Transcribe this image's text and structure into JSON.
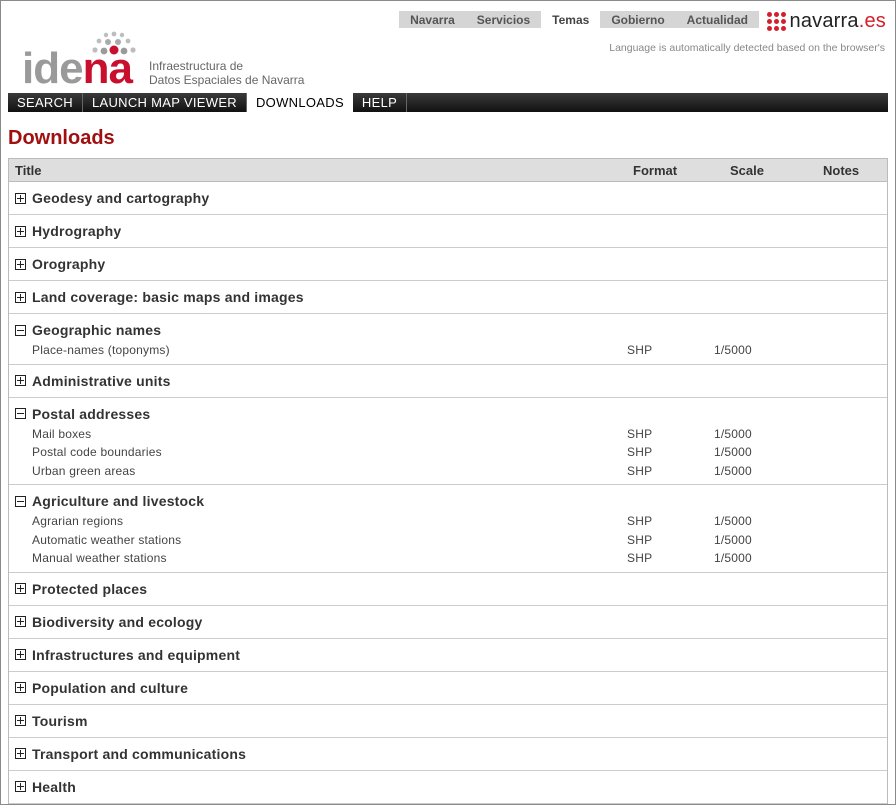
{
  "portal": {
    "nav": [
      {
        "label": "Navarra",
        "active": false
      },
      {
        "label": "Servicios",
        "active": false
      },
      {
        "label": "Temas",
        "active": true
      },
      {
        "label": "Gobierno",
        "active": false
      },
      {
        "label": "Actualidad",
        "active": false
      }
    ],
    "brand_main": "navarra",
    "brand_tld": ".es",
    "language_note": "Language is automatically detected based on the browser's"
  },
  "logo": {
    "word_grey": "ide",
    "word_red": "na",
    "subtitle_line1": "Infraestructura de",
    "subtitle_line2": "Datos Espaciales de Navarra"
  },
  "menu": [
    {
      "label": "SEARCH",
      "active": false
    },
    {
      "label": "LAUNCH MAP VIEWER",
      "active": false
    },
    {
      "label": "DOWNLOADS",
      "active": true
    },
    {
      "label": "HELP",
      "active": false
    }
  ],
  "page_title": "Downloads",
  "table": {
    "headers": {
      "title": "Title",
      "format": "Format",
      "scale": "Scale",
      "notes": "Notes"
    },
    "groups": [
      {
        "name": "Geodesy and cartography",
        "expanded": false,
        "items": []
      },
      {
        "name": "Hydrography",
        "expanded": false,
        "items": []
      },
      {
        "name": "Orography",
        "expanded": false,
        "items": []
      },
      {
        "name": "Land coverage: basic maps and images",
        "expanded": false,
        "items": []
      },
      {
        "name": "Geographic names",
        "expanded": true,
        "items": [
          {
            "title": "Place-names (toponyms)",
            "format": "SHP",
            "scale": "1/5000"
          }
        ]
      },
      {
        "name": "Administrative units",
        "expanded": false,
        "items": []
      },
      {
        "name": "Postal addresses",
        "expanded": true,
        "items": [
          {
            "title": "Mail boxes",
            "format": "SHP",
            "scale": "1/5000"
          },
          {
            "title": "Postal code boundaries",
            "format": "SHP",
            "scale": "1/5000"
          },
          {
            "title": "Urban green areas",
            "format": "SHP",
            "scale": "1/5000"
          }
        ]
      },
      {
        "name": "Agriculture and livestock",
        "expanded": true,
        "items": [
          {
            "title": "Agrarian regions",
            "format": "SHP",
            "scale": "1/5000"
          },
          {
            "title": "Automatic weather stations",
            "format": "SHP",
            "scale": "1/5000"
          },
          {
            "title": "Manual weather stations",
            "format": "SHP",
            "scale": "1/5000"
          }
        ]
      },
      {
        "name": "Protected places",
        "expanded": false,
        "items": []
      },
      {
        "name": "Biodiversity and ecology",
        "expanded": false,
        "items": []
      },
      {
        "name": "Infrastructures and equipment",
        "expanded": false,
        "items": []
      },
      {
        "name": "Population and culture",
        "expanded": false,
        "items": []
      },
      {
        "name": "Tourism",
        "expanded": false,
        "items": []
      },
      {
        "name": "Transport and communications",
        "expanded": false,
        "items": []
      },
      {
        "name": "Health",
        "expanded": false,
        "items": []
      }
    ]
  },
  "colors": {
    "accent_red": "#c8102e",
    "title_red": "#a01010"
  }
}
